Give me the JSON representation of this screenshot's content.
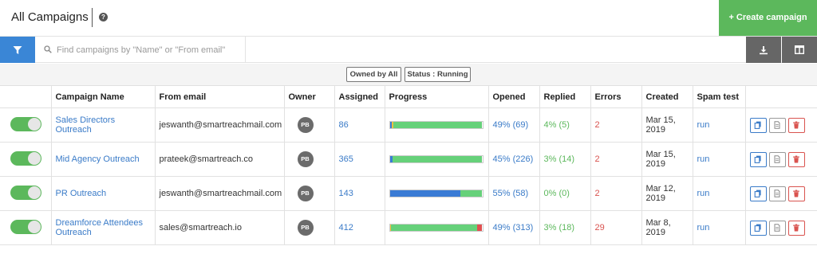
{
  "header": {
    "title": "All Campaigns",
    "create_label": "+ Create campaign"
  },
  "search": {
    "placeholder": "Find campaigns by \"Name\" or \"From email\""
  },
  "filters": {
    "owned": "Owned by All",
    "status": "Status : Running"
  },
  "table": {
    "columns": [
      "",
      "Campaign Name",
      "From email",
      "Owner",
      "Assigned",
      "Progress",
      "Opened",
      "Replied",
      "Errors",
      "Created",
      "Spam test",
      ""
    ],
    "rows": [
      {
        "enabled": true,
        "name": "Sales Directors Outreach",
        "from_email": "jeswanth@smartreachmail.com",
        "owner": "PB",
        "assigned": "86",
        "progress": [
          {
            "fraction": 0.02,
            "color": "#3a7bd5"
          },
          {
            "fraction": 0.02,
            "color": "#f0c040"
          },
          {
            "fraction": 0.96,
            "color": "#66d17a"
          }
        ],
        "opened": "49% (69)",
        "replied": "4% (5)",
        "errors": "2",
        "created": "Mar 15, 2019",
        "spam_test": "run"
      },
      {
        "enabled": true,
        "name": "Mid Agency Outreach",
        "from_email": "prateek@smartreach.co",
        "owner": "PB",
        "assigned": "365",
        "progress": [
          {
            "fraction": 0.03,
            "color": "#3a7bd5"
          },
          {
            "fraction": 0.97,
            "color": "#66d17a"
          }
        ],
        "opened": "45% (226)",
        "replied": "3% (14)",
        "errors": "2",
        "created": "Mar 15, 2019",
        "spam_test": "run"
      },
      {
        "enabled": true,
        "name": "PR Outreach",
        "from_email": "jeswanth@smartreachmail.com",
        "owner": "PB",
        "assigned": "143",
        "progress": [
          {
            "fraction": 0.76,
            "color": "#3a7bd5"
          },
          {
            "fraction": 0.24,
            "color": "#66d17a"
          }
        ],
        "opened": "55% (58)",
        "replied": "0% (0)",
        "errors": "2",
        "created": "Mar 12, 2019",
        "spam_test": "run"
      },
      {
        "enabled": true,
        "name": "Dreamforce Attendees Outreach",
        "from_email": "sales@smartreach.io",
        "owner": "PB",
        "assigned": "412",
        "progress": [
          {
            "fraction": 0.01,
            "color": "#f0c040"
          },
          {
            "fraction": 0.93,
            "color": "#66d17a"
          },
          {
            "fraction": 0.06,
            "color": "#e05050"
          }
        ],
        "opened": "49% (313)",
        "replied": "3% (18)",
        "errors": "29",
        "created": "Mar 8, 2019",
        "spam_test": "run"
      }
    ]
  },
  "icons": {
    "help": "question-circle-icon",
    "filter": "filter-icon",
    "search": "search-icon",
    "download": "download-icon",
    "columns": "columns-icon",
    "copy": "copy-icon",
    "doc": "document-icon",
    "delete": "trash-icon"
  },
  "colors": {
    "primary": "#3a86d6",
    "success": "#5cb85c",
    "danger": "#d9534f",
    "link": "#3a7bc8"
  }
}
